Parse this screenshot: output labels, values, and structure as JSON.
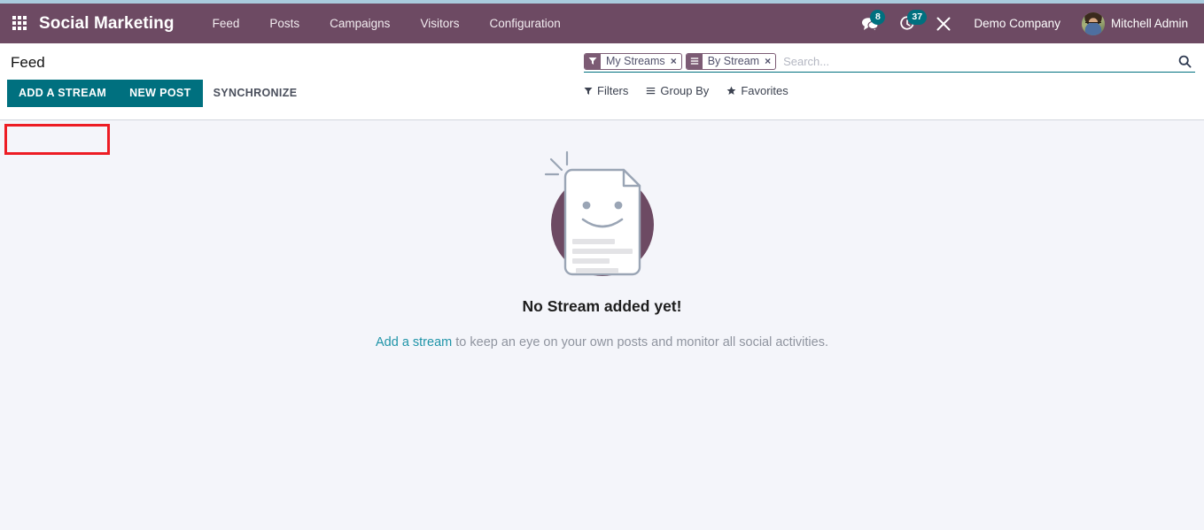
{
  "navbar": {
    "apps_icon": "apps-grid-icon",
    "brand": "Social Marketing",
    "menu": [
      {
        "label": "Feed"
      },
      {
        "label": "Posts"
      },
      {
        "label": "Campaigns"
      },
      {
        "label": "Visitors"
      },
      {
        "label": "Configuration"
      }
    ],
    "messages": {
      "icon": "chat-bubble-icon",
      "count": "8"
    },
    "activities": {
      "icon": "clock-icon",
      "count": "37"
    },
    "debug": {
      "icon": "tools-icon"
    },
    "company": "Demo Company",
    "user": {
      "name": "Mitchell Admin",
      "avatar_icon": "user-avatar"
    }
  },
  "control_panel": {
    "breadcrumb": "Feed",
    "buttons": {
      "add_stream": "ADD A STREAM",
      "new_post": "NEW POST",
      "synchronize": "SYNCHRONIZE"
    },
    "search": {
      "placeholder": "Search...",
      "facets": [
        {
          "icon": "filter-icon",
          "label": "My Streams",
          "remove": "×"
        },
        {
          "icon": "group-by-icon",
          "label": "By Stream",
          "remove": "×"
        }
      ],
      "magnifier_icon": "search-icon"
    },
    "dropdowns": [
      {
        "icon": "filter-icon",
        "label": "Filters"
      },
      {
        "icon": "group-by-icon",
        "label": "Group By"
      },
      {
        "icon": "star-icon",
        "label": "Favorites"
      }
    ]
  },
  "main": {
    "empty_state": {
      "illustration": "smiling-document-icon",
      "title": "No Stream added yet!",
      "link_text": "Add a stream",
      "description": " to keep an eye on your own posts and monitor all social activities."
    }
  },
  "annotation": {
    "highlight_target": "ADD A STREAM",
    "color": "#ed1c24"
  },
  "colors": {
    "navbar_bg": "#6d4a63",
    "primary": "#00707f",
    "content_bg": "#f4f5fa",
    "link": "#1f94a8",
    "facet_bg": "#7c5b74"
  }
}
